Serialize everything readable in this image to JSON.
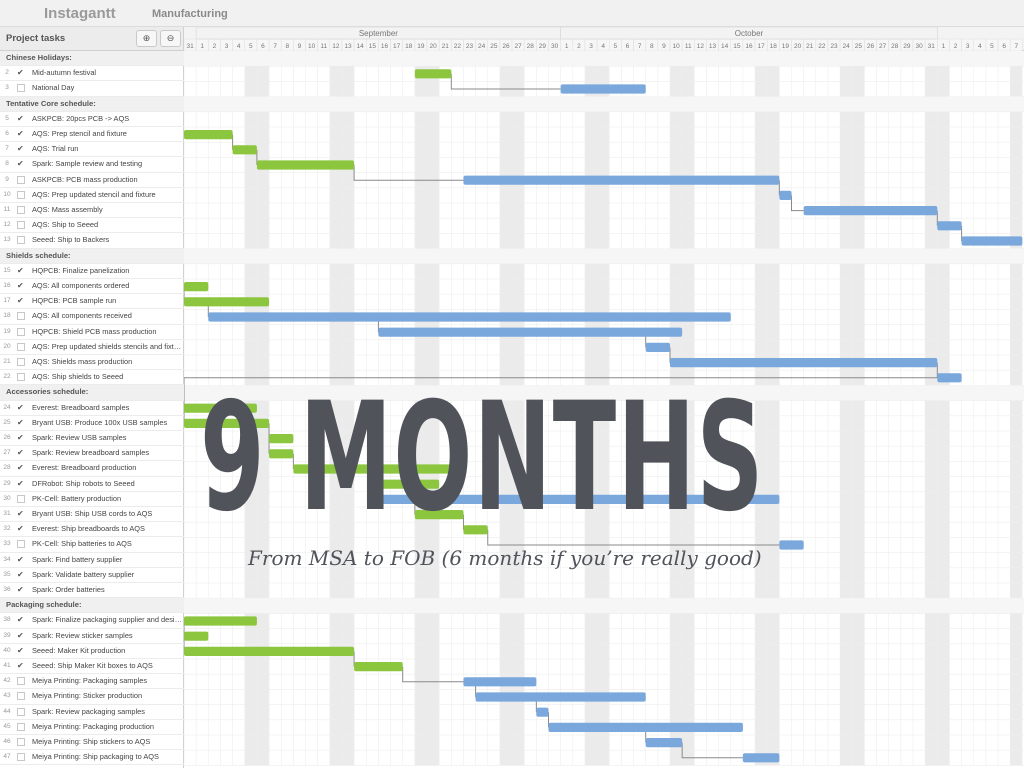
{
  "app": {
    "name": "Instagantt",
    "project": "Manufacturing"
  },
  "task_header": {
    "label": "Project tasks",
    "zoom_in_icon": "zoom-in-icon",
    "zoom_out_icon": "zoom-out-icon"
  },
  "calendar": {
    "months": [
      {
        "label": "September"
      },
      {
        "label": "October"
      }
    ],
    "days": [
      "31",
      "1",
      "2",
      "3",
      "4",
      "5",
      "6",
      "7",
      "8",
      "9",
      "10",
      "11",
      "12",
      "13",
      "14",
      "15",
      "16",
      "17",
      "18",
      "19",
      "20",
      "21",
      "22",
      "23",
      "24",
      "25",
      "26",
      "27",
      "28",
      "29",
      "30",
      "1",
      "2",
      "3",
      "4",
      "5",
      "6",
      "7",
      "8",
      "9",
      "10",
      "11",
      "12",
      "13",
      "14",
      "15",
      "16",
      "17",
      "18",
      "19",
      "20",
      "21",
      "22",
      "23",
      "24",
      "25",
      "26",
      "27",
      "28",
      "29",
      "30",
      "31",
      "1",
      "2",
      "3",
      "4",
      "5",
      "6",
      "7"
    ]
  },
  "colors": {
    "green": "#8cc63f",
    "blue": "#7aa7dc",
    "weekend": "#ebebeb",
    "connector": "#8a8a8a",
    "overlay": "#50545a"
  },
  "rows": [
    {
      "type": "section",
      "name": "Chinese Holidays:"
    },
    {
      "type": "task",
      "num": "2",
      "done": true,
      "name": "Mid-autumn festival",
      "bar": {
        "start": 19,
        "end": 22,
        "color": "green"
      }
    },
    {
      "type": "task",
      "num": "3",
      "done": false,
      "name": "National Day",
      "bar": {
        "start": 31,
        "end": 38,
        "color": "blue"
      }
    },
    {
      "type": "section",
      "name": "Tentative Core schedule:"
    },
    {
      "type": "task",
      "num": "5",
      "done": true,
      "name": "ASKPCB: 20pcs PCB -> AQS"
    },
    {
      "type": "task",
      "num": "6",
      "done": true,
      "name": "AQS: Prep stencil and fixture",
      "bar": {
        "start": 0,
        "end": 4,
        "color": "green"
      }
    },
    {
      "type": "task",
      "num": "7",
      "done": true,
      "name": "AQS: Trial run",
      "bar": {
        "start": 4,
        "end": 6,
        "color": "green"
      }
    },
    {
      "type": "task",
      "num": "8",
      "done": true,
      "name": "Spark: Sample review and testing",
      "bar": {
        "start": 6,
        "end": 14,
        "color": "green"
      }
    },
    {
      "type": "task",
      "num": "9",
      "done": false,
      "name": "ASKPCB: PCB mass production",
      "bar": {
        "start": 23,
        "end": 49,
        "color": "blue"
      }
    },
    {
      "type": "task",
      "num": "10",
      "done": false,
      "name": "AQS: Prep updated stencil and fixture",
      "bar": {
        "start": 49,
        "end": 50,
        "color": "blue"
      }
    },
    {
      "type": "task",
      "num": "11",
      "done": false,
      "name": "AQS: Mass assembly",
      "bar": {
        "start": 51,
        "end": 62,
        "color": "blue"
      }
    },
    {
      "type": "task",
      "num": "12",
      "done": false,
      "name": "AQS: Ship to Seeed",
      "bar": {
        "start": 62,
        "end": 64,
        "color": "blue"
      }
    },
    {
      "type": "task",
      "num": "13",
      "done": false,
      "name": "Seeed: Ship to Backers",
      "bar": {
        "start": 64,
        "end": 69,
        "color": "blue"
      }
    },
    {
      "type": "section",
      "name": "Shields schedule:"
    },
    {
      "type": "task",
      "num": "15",
      "done": true,
      "name": "HQPCB: Finalize panelization"
    },
    {
      "type": "task",
      "num": "16",
      "done": true,
      "name": "AQS: All components ordered",
      "bar": {
        "start": 0,
        "end": 2,
        "color": "green"
      }
    },
    {
      "type": "task",
      "num": "17",
      "done": true,
      "name": "HQPCB: PCB sample run",
      "bar": {
        "start": 0,
        "end": 7,
        "color": "green"
      }
    },
    {
      "type": "task",
      "num": "18",
      "done": false,
      "name": "AQS: All components received",
      "bar": {
        "start": 2,
        "end": 45,
        "color": "blue"
      }
    },
    {
      "type": "task",
      "num": "19",
      "done": false,
      "name": "HQPCB: Shield PCB mass production",
      "bar": {
        "start": 16,
        "end": 41,
        "color": "blue"
      }
    },
    {
      "type": "task",
      "num": "20",
      "done": false,
      "name": "AQS: Prep updated shields stencils and fixtures",
      "bar": {
        "start": 38,
        "end": 40,
        "color": "blue"
      }
    },
    {
      "type": "task",
      "num": "21",
      "done": false,
      "name": "AQS: Shields mass production",
      "bar": {
        "start": 40,
        "end": 62,
        "color": "blue"
      }
    },
    {
      "type": "task",
      "num": "22",
      "done": false,
      "name": "AQS: Ship shields to Seeed",
      "bar": {
        "start": 62,
        "end": 64,
        "color": "blue"
      }
    },
    {
      "type": "section",
      "name": "Accessories schedule:"
    },
    {
      "type": "task",
      "num": "24",
      "done": true,
      "name": "Everest: Breadboard samples",
      "bar": {
        "start": 0,
        "end": 6,
        "color": "green"
      }
    },
    {
      "type": "task",
      "num": "25",
      "done": true,
      "name": "Bryant USB: Produce 100x USB samples",
      "bar": {
        "start": 0,
        "end": 7,
        "color": "green"
      }
    },
    {
      "type": "task",
      "num": "26",
      "done": true,
      "name": "Spark: Review USB samples",
      "bar": {
        "start": 7,
        "end": 9,
        "color": "green"
      }
    },
    {
      "type": "task",
      "num": "27",
      "done": true,
      "name": "Spark: Review breadboard samples",
      "bar": {
        "start": 7,
        "end": 9,
        "color": "green"
      }
    },
    {
      "type": "task",
      "num": "28",
      "done": true,
      "name": "Everest: Breadboard production",
      "bar": {
        "start": 9,
        "end": 23,
        "color": "green"
      }
    },
    {
      "type": "task",
      "num": "29",
      "done": true,
      "name": "DFRobot: Ship robots to Seeed",
      "bar": {
        "start": 16,
        "end": 21,
        "color": "green"
      }
    },
    {
      "type": "task",
      "num": "30",
      "done": false,
      "name": "PK-Cell: Battery production",
      "bar": {
        "start": 16,
        "end": 49,
        "color": "blue"
      }
    },
    {
      "type": "task",
      "num": "31",
      "done": true,
      "name": "Bryant USB: Ship USB cords to AQS",
      "bar": {
        "start": 19,
        "end": 23,
        "color": "green"
      }
    },
    {
      "type": "task",
      "num": "32",
      "done": true,
      "name": "Everest: Ship breadboards to AQS",
      "bar": {
        "start": 23,
        "end": 25,
        "color": "green"
      }
    },
    {
      "type": "task",
      "num": "33",
      "done": false,
      "name": "PK-Cell: Ship batteries to AQS",
      "bar": {
        "start": 49,
        "end": 51,
        "color": "blue"
      }
    },
    {
      "type": "task",
      "num": "34",
      "done": true,
      "name": "Spark: Find battery supplier"
    },
    {
      "type": "task",
      "num": "35",
      "done": true,
      "name": "Spark: Validate battery supplier"
    },
    {
      "type": "task",
      "num": "36",
      "done": true,
      "name": "Spark: Order batteries"
    },
    {
      "type": "section",
      "name": "Packaging schedule:"
    },
    {
      "type": "task",
      "num": "38",
      "done": true,
      "name": "Spark: Finalize packaging supplier and design",
      "bar": {
        "start": 0,
        "end": 6,
        "color": "green"
      }
    },
    {
      "type": "task",
      "num": "39",
      "done": true,
      "name": "Spark: Review sticker samples",
      "bar": {
        "start": 0,
        "end": 2,
        "color": "green"
      }
    },
    {
      "type": "task",
      "num": "40",
      "done": true,
      "name": "Seeed: Maker Kit production",
      "bar": {
        "start": 0,
        "end": 14,
        "color": "green"
      }
    },
    {
      "type": "task",
      "num": "41",
      "done": true,
      "name": "Seeed: Ship Maker Kit boxes to AQS",
      "bar": {
        "start": 14,
        "end": 18,
        "color": "green"
      }
    },
    {
      "type": "task",
      "num": "42",
      "done": false,
      "name": "Meiya Printing: Packaging samples",
      "bar": {
        "start": 23,
        "end": 29,
        "color": "blue"
      }
    },
    {
      "type": "task",
      "num": "43",
      "done": false,
      "name": "Meiya Printing: Sticker production",
      "bar": {
        "start": 24,
        "end": 38,
        "color": "blue"
      }
    },
    {
      "type": "task",
      "num": "44",
      "done": false,
      "name": "Spark: Review packaging samples",
      "bar": {
        "start": 29,
        "end": 30,
        "color": "blue"
      }
    },
    {
      "type": "task",
      "num": "45",
      "done": false,
      "name": "Meiya Printing: Packaging production",
      "bar": {
        "start": 30,
        "end": 46,
        "color": "blue"
      }
    },
    {
      "type": "task",
      "num": "46",
      "done": false,
      "name": "Meiya Printing: Ship stickers to AQS",
      "bar": {
        "start": 38,
        "end": 41,
        "color": "blue"
      }
    },
    {
      "type": "task",
      "num": "47",
      "done": false,
      "name": "Meiya Printing: Ship packaging to AQS",
      "bar": {
        "start": 46,
        "end": 49,
        "color": "blue"
      }
    }
  ],
  "overlay": {
    "title": "9 MONTHS",
    "subtitle": "From MSA to FOB (6 months if you’re really good)"
  }
}
